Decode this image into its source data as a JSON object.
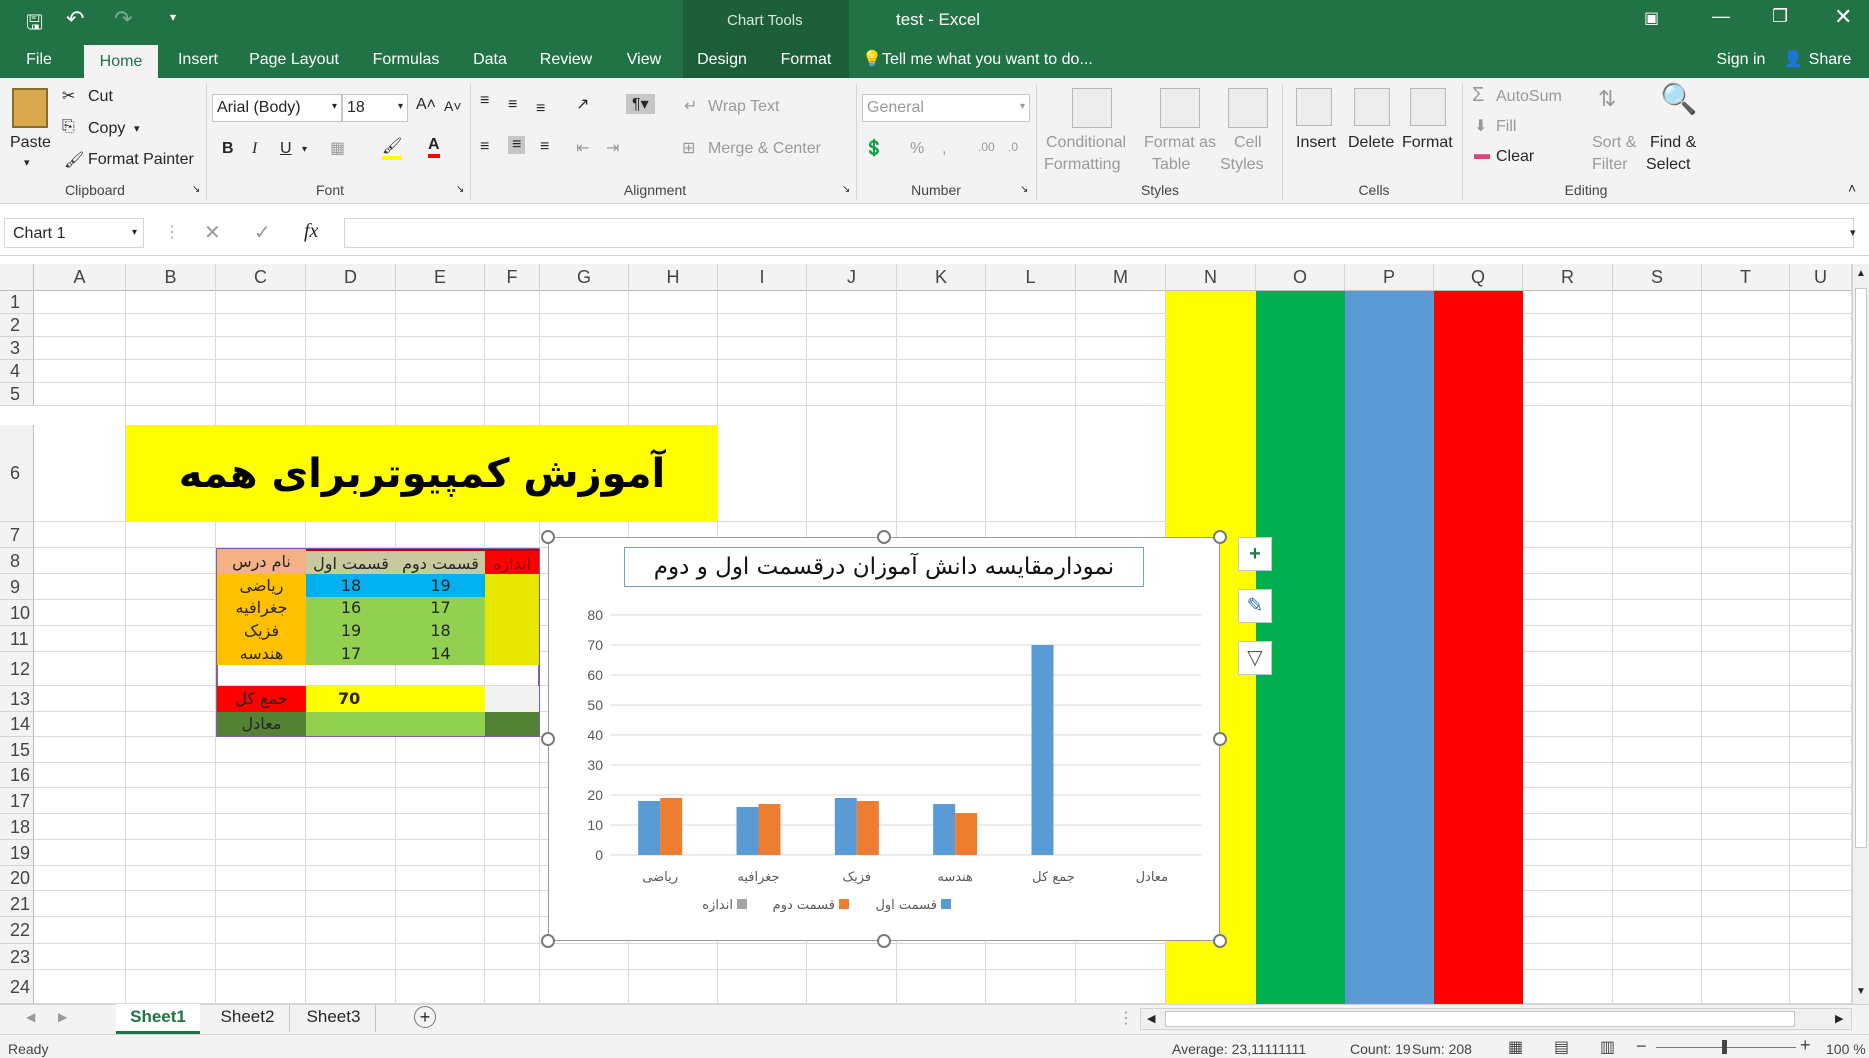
{
  "window": {
    "title": "test - Excel",
    "chart_tools": "Chart Tools"
  },
  "qat": {
    "save": "save-icon",
    "undo": "undo-icon",
    "redo": "redo-icon"
  },
  "tabs": [
    "File",
    "Home",
    "Insert",
    "Page Layout",
    "Formulas",
    "Data",
    "Review",
    "View",
    "Design",
    "Format"
  ],
  "tell_me": "Tell me what you want to do...",
  "sign_in": "Sign in",
  "share": "Share",
  "ribbon": {
    "clipboard": {
      "paste": "Paste",
      "cut": "Cut",
      "copy": "Copy",
      "format_painter": "Format Painter",
      "label": "Clipboard"
    },
    "font": {
      "name": "Arial (Body)",
      "size": "18",
      "bold": "B",
      "italic": "I",
      "underline": "U",
      "label": "Font"
    },
    "alignment": {
      "wrap": "Wrap Text",
      "merge": "Merge & Center",
      "label": "Alignment"
    },
    "number": {
      "format": "General",
      "percent": "%",
      "label": "Number"
    },
    "styles": {
      "conditional": "Conditional",
      "conditional2": "Formatting",
      "format_as": "Format as",
      "format_as2": "Table",
      "cell": "Cell",
      "cell2": "Styles",
      "label": "Styles"
    },
    "cells": {
      "insert": "Insert",
      "delete": "Delete",
      "format": "Format",
      "label": "Cells"
    },
    "editing": {
      "autosum": "AutoSum",
      "fill": "Fill",
      "clear": "Clear",
      "sort": "Sort &",
      "sort2": "Filter",
      "find": "Find &",
      "find2": "Select",
      "label": "Editing"
    }
  },
  "name_box": "Chart 1",
  "fx": "fx",
  "columns": [
    "A",
    "B",
    "C",
    "D",
    "E",
    "F",
    "G",
    "H",
    "I",
    "J",
    "K",
    "L",
    "M",
    "N",
    "O",
    "P",
    "Q",
    "R",
    "S",
    "T",
    "U"
  ],
  "rows": [
    "1",
    "2",
    "3",
    "4",
    "5",
    "6",
    "7",
    "8",
    "9",
    "10",
    "11",
    "12",
    "13",
    "14",
    "15",
    "16",
    "17",
    "18",
    "19",
    "20",
    "21",
    "22",
    "23",
    "24"
  ],
  "banner": "آموزش کمپیوتربرای همه",
  "table": {
    "headers": {
      "name": "نام درس",
      "part1": "قسمت اول",
      "part2": "قسمت دوم",
      "size": "اندازه"
    },
    "rows": [
      {
        "name": "ریاضی",
        "p1": "18",
        "p2": "19"
      },
      {
        "name": "جغرافیه",
        "p1": "16",
        "p2": "17"
      },
      {
        "name": "فزیک",
        "p1": "19",
        "p2": "18"
      },
      {
        "name": "هندسه",
        "p1": "17",
        "p2": "14"
      }
    ],
    "total_label": "جمع کل",
    "total_value": "70",
    "avg_label": "معادل"
  },
  "chart_data": {
    "type": "bar",
    "title": "نمودارمقایسه دانش آموزان درقسمت اول و دوم",
    "categories": [
      "ریاضی",
      "جغرافیه",
      "فزیک",
      "هندسه",
      "جمع کل",
      "معادل"
    ],
    "series": [
      {
        "name": "قسمت اول",
        "color": "#5b9bd5",
        "values": [
          18,
          16,
          19,
          17,
          70,
          null
        ]
      },
      {
        "name": "قسمت دوم",
        "color": "#ed7d31",
        "values": [
          19,
          17,
          18,
          14,
          null,
          null
        ]
      },
      {
        "name": "اندازه",
        "color": "#a5a5a5",
        "values": [
          null,
          null,
          null,
          null,
          null,
          null
        ]
      }
    ],
    "ylim": [
      0,
      80
    ],
    "yticks": [
      0,
      10,
      20,
      30,
      40,
      50,
      60,
      70,
      80
    ],
    "xlabel": "",
    "ylabel": "",
    "grid": true,
    "legend": "bottom"
  },
  "sheets": [
    "Sheet1",
    "Sheet2",
    "Sheet3"
  ],
  "status": {
    "ready": "Ready",
    "average": "Average: 23,11111111",
    "count": "Count: 19",
    "sum": "Sum: 208",
    "zoom": "100 %"
  },
  "colors": {
    "excel_green": "#217346",
    "yellow": "#ffff00",
    "green": "#00b050",
    "blue": "#5b9bd5",
    "red": "#ff0000"
  }
}
